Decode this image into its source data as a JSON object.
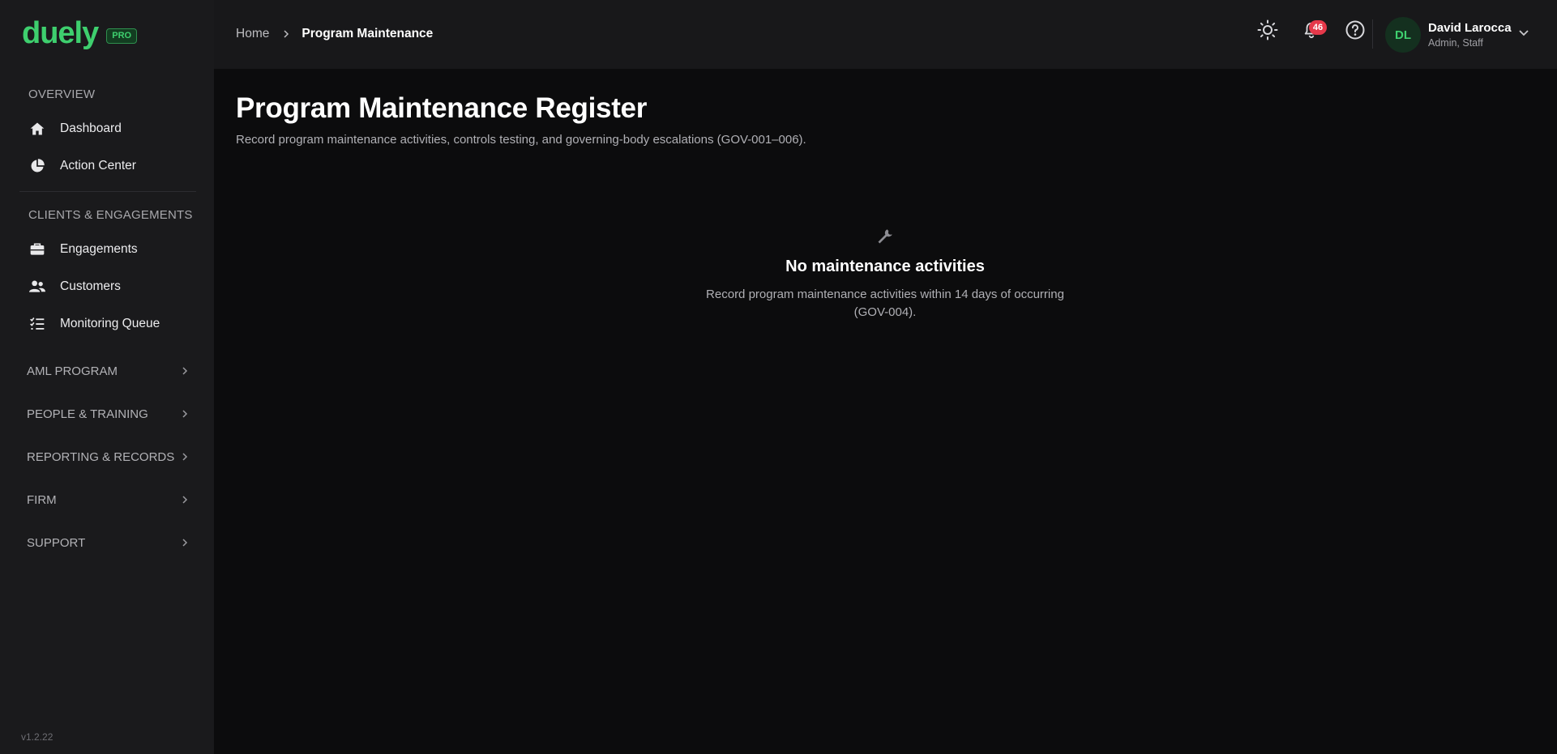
{
  "brand": {
    "name": "duely",
    "badge": "PRO",
    "accent": "#3ecf6e"
  },
  "sidebar": {
    "sections": [
      {
        "title": "OVERVIEW",
        "items": [
          {
            "label": "Dashboard",
            "icon": "home-icon"
          },
          {
            "label": "Action Center",
            "icon": "pie-chart-icon"
          }
        ]
      },
      {
        "title": "CLIENTS & ENGAGEMENTS",
        "items": [
          {
            "label": "Engagements",
            "icon": "briefcase-icon"
          },
          {
            "label": "Customers",
            "icon": "users-icon"
          },
          {
            "label": "Monitoring Queue",
            "icon": "list-check-icon"
          }
        ]
      }
    ],
    "groups": [
      {
        "label": "AML PROGRAM"
      },
      {
        "label": "PEOPLE & TRAINING"
      },
      {
        "label": "REPORTING & RECORDS"
      },
      {
        "label": "FIRM"
      },
      {
        "label": "SUPPORT"
      }
    ],
    "version": "v1.2.22"
  },
  "header": {
    "breadcrumb": {
      "home": "Home",
      "current": "Program Maintenance"
    },
    "notifications_count": "46",
    "user": {
      "initials": "DL",
      "name": "David Larocca",
      "role": "Admin, Staff"
    }
  },
  "main": {
    "title": "Program Maintenance Register",
    "subtitle": "Record program maintenance activities, controls testing, and governing-body escalations (GOV-001–006).",
    "empty_state": {
      "icon": "wrench-icon",
      "title": "No maintenance activities",
      "text": "Record program maintenance activities within 14 days of occurring (GOV-004)."
    }
  }
}
